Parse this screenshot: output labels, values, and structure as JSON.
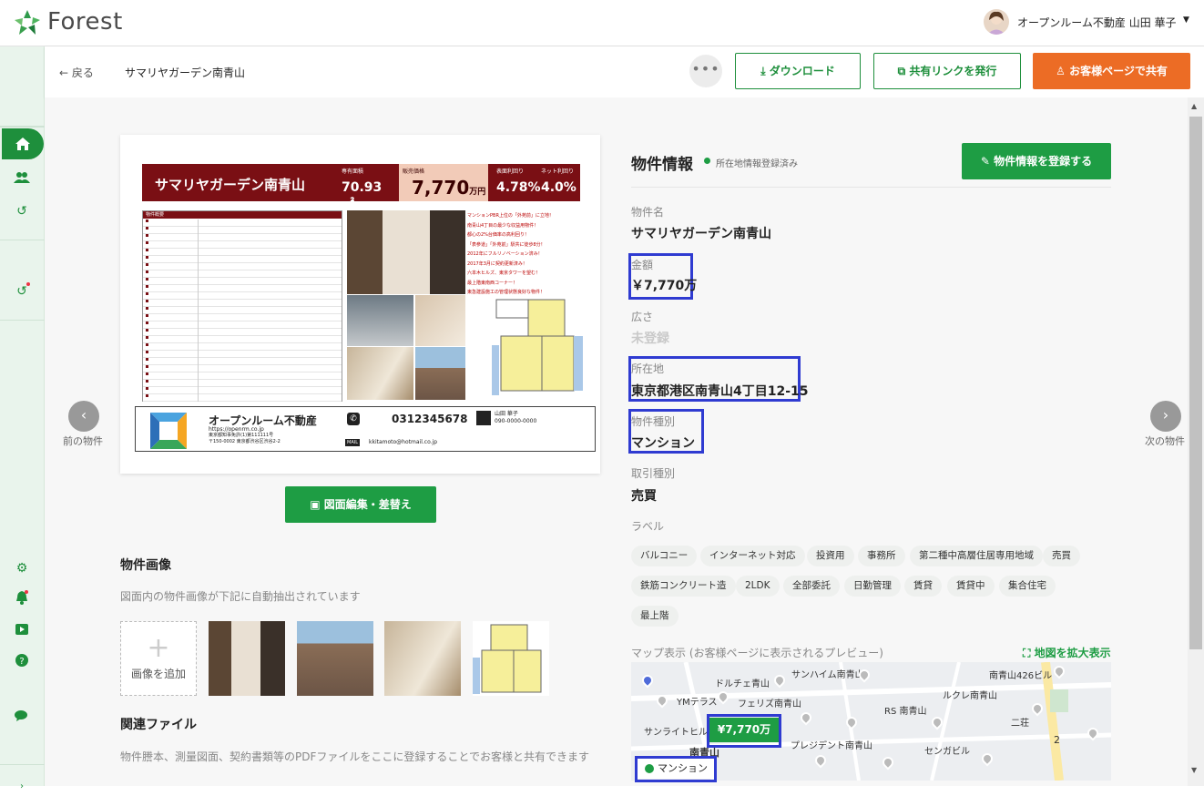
{
  "app": {
    "name": "Forest"
  },
  "user": {
    "company_name": "オープンルーム不動産 山田 華子"
  },
  "subheader": {
    "back_label": "← 戻る",
    "property_title": "サマリヤガーデン南青山",
    "more_label": "•••",
    "download_label": "ダウンロード",
    "share_link_label": "共有リンクを発行",
    "share_page_label": "お客様ページで共有"
  },
  "flyer": {
    "name": "サマリヤガーデン南青山",
    "area_label": "専有面積",
    "area_value": "70.93㎡",
    "price_label": "販売価格",
    "price_value": "7,770",
    "price_unit": "万円",
    "gross_label": "表面利回り",
    "gross_value": "4.78%",
    "net_label": "ネット利回り",
    "net_value": "4.0%",
    "table_header": "物件概要",
    "bullets": [
      "マンションPBR上位の「外苑前」に立地！",
      "南青山4丁目の最少な収益用物件！",
      "都心の2%台価率の高利回り！",
      "「表参道」「外苑前」駅共に徒歩8分！",
      "2012年にフルリノベーション済み！",
      "2017年3月に契約更新済み！",
      "六本木ヒルズ、東京タワーを望む！",
      "最上階東南西コーナー！",
      "東急建設施工の管理状態良好な物件！"
    ],
    "company": "オープンルーム不動産",
    "company_url": "https://openrm.co.jp",
    "company_addr1": "東京都知事免許(1)第111111号",
    "company_addr2": "〒150-0002 東京都渋谷区渋谷2-2",
    "tel": "0312345678",
    "agent_name": "山田 華子",
    "agent_phone": "090-0000-0000",
    "mail_label": "MAIL",
    "mail": "kkitamoto@hotmail.co.jp"
  },
  "nav": {
    "prev_label": "前の物件",
    "next_label": "次の物件"
  },
  "drawing_button_label": "図面編集・差替え",
  "images_section": {
    "title": "物件画像",
    "description": "図面内の物件画像が下記に自動抽出されています",
    "add_label": "画像を追加"
  },
  "files_section": {
    "title": "関連ファイル",
    "description": "物件謄本、測量図面、契約書類等のPDFファイルをここに登録することでお客様と共有できます"
  },
  "info": {
    "title": "物件情報",
    "status": "所在地情報登録済み",
    "register_label": "物件情報を登録する",
    "fields": [
      {
        "label": "物件名",
        "value": "サマリヤガーデン南青山"
      },
      {
        "label": "金額",
        "value": "￥7,770万"
      },
      {
        "label": "広さ",
        "value": "未登録"
      },
      {
        "label": "所在地",
        "value": "東京都港区南青山4丁目12-15"
      },
      {
        "label": "物件種別",
        "value": "マンション"
      },
      {
        "label": "取引種別",
        "value": "売買"
      }
    ],
    "labels_title": "ラベル",
    "labels": [
      "バルコニー",
      "インターネット対応",
      "投資用",
      "事務所",
      "第二種中高層住居専用地域",
      "売買",
      "鉄筋コンクリート造",
      "2LDK",
      "全部委託",
      "日勤管理",
      "賃貸",
      "賃貸中",
      "集合住宅",
      "最上階"
    ]
  },
  "map": {
    "label": "マップ表示 (お客様ページに表示されるプレビュー)",
    "expand_label": "地図を拡大表示",
    "price_tag": "¥7,770万",
    "type_tag": "マンション",
    "places": [
      "サンハイム南青山",
      "南青山426ビル",
      "ドルチェ青山",
      "YMテラス",
      "フェリズ南青山",
      "ルクレ南青山",
      "RS 南青山",
      "サンライトヒル青山",
      "二荘",
      "プレジデント南青山",
      "センガビル",
      "南青山",
      "2"
    ]
  }
}
